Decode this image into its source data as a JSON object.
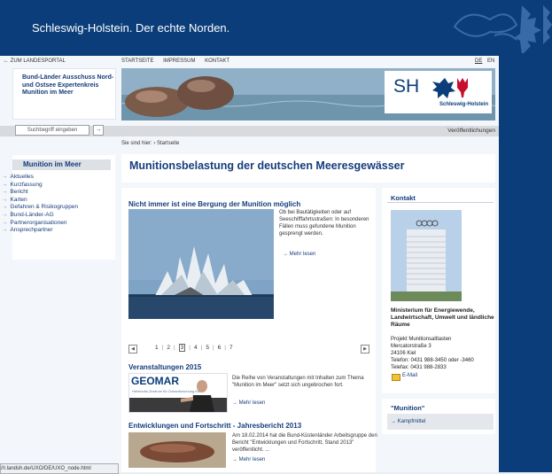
{
  "header": {
    "title": "Schleswig-Holstein. Der echte Norden."
  },
  "toplinks": {
    "back": "← ZUM LANDESPORTAL",
    "start": "STARTSEITE",
    "impressum": "IMPRESSUM",
    "kontakt": "KONTAKT",
    "lang_de": "DE",
    "lang_en": "EN"
  },
  "leftbox": {
    "title": "Bund-Länder Ausschuss Nord- und Ostsee Expertenkreis Munition im Meer"
  },
  "logo": {
    "sh": "SH",
    "name": "Schleswig-Holstein"
  },
  "search": {
    "placeholder": "Suchbegriff eingeben",
    "go": "→",
    "publications": "Veröffentlichungen"
  },
  "breadcrumb": "Sie sind hier: › Startseite",
  "sidebar": {
    "title": "Munition im Meer",
    "items": [
      {
        "label": "Aktuelles"
      },
      {
        "label": "Kurzfassung"
      },
      {
        "label": "Bericht"
      },
      {
        "label": "Karten"
      },
      {
        "label": "Gefahren & Risikogruppen"
      },
      {
        "label": "Bund-Länder-AG"
      },
      {
        "label": "Partnerorganisationen"
      },
      {
        "label": "Ansprechpartner"
      }
    ],
    "arrow": "→"
  },
  "main": {
    "title": "Munitionsbelastung der deutschen Meeresgewässer",
    "feature": {
      "title": "Nicht immer ist eine Bergung der Munition möglich",
      "text": "Ob bei Bautätigkeiten oder auf Seeschifffahrtsstraßen: In besonderen Fällen muss gefundene Munition gesprengt werden.",
      "more": "→ Mehr lesen"
    },
    "pager": {
      "prev": "◀",
      "next": "▶",
      "pages": [
        "1",
        "2",
        "3",
        "4",
        "5",
        "6",
        "7"
      ],
      "current": "3"
    },
    "events": {
      "title": "Veranstaltungen 2015",
      "logo": "GEOMAR",
      "logo_sub": "Helmholtz-Zentrum für Ozeanforschung Kiel",
      "text": "Die Reihe von Veranstaltungen mit Inhalten zum Thema \"Munition im Meer\" setzt sich ungebrochen fort.",
      "more": "→ Mehr lesen"
    },
    "report": {
      "title": "Entwicklungen und Fortschritt - Jahresbericht 2013",
      "text": "Am 18.02.2014 hat die Bund-Küstenländer Arbeitsgruppe den Bericht \"Entwicklungen und Fortschritt, Stand 2013\" veröffentlicht. ...",
      "more": "→ Mehr lesen"
    }
  },
  "contact": {
    "title": "Kontakt",
    "org": "Ministerium für Energiewende, Landwirtschaft, Umwelt und ländliche Räume",
    "project": "Projekt Munitionsaltlasten",
    "street": "Mercatorstraße 3",
    "city": "24106 Kiel",
    "phone": "Telefon: 0431 988-3450 oder -3460",
    "fax": "Telefax: 0431 988-2833",
    "email": "E-Mail"
  },
  "munition_box": {
    "title": "\"Munition\"",
    "link": "→ Kampfmittel"
  },
  "status": {
    "url": "//r.landsh.de/UXO/DE/UXO_node.html"
  },
  "colors": {
    "brand": "#0a3d7a",
    "link": "#163d7c",
    "accent_red": "#c8102e"
  }
}
